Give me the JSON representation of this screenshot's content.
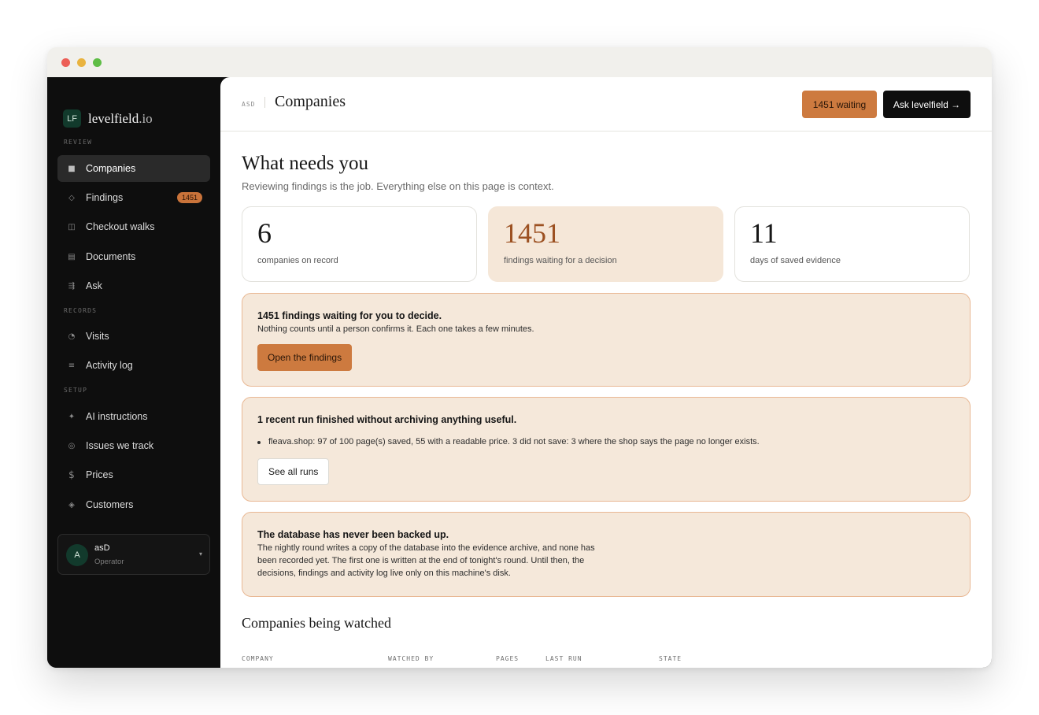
{
  "brand": {
    "mark": "LF",
    "name": "levelfield",
    "tld": ".io"
  },
  "sidebar": {
    "sections": [
      {
        "label": "REVIEW"
      },
      {
        "label": "RECORDS"
      },
      {
        "label": "SETUP"
      }
    ],
    "items": [
      {
        "label": "Companies",
        "icon": "■",
        "icon_name": "companies-icon",
        "active": true
      },
      {
        "label": "Findings",
        "icon": "◇",
        "icon_name": "findings-icon",
        "badge": "1451"
      },
      {
        "label": "Checkout walks",
        "icon": "◫",
        "icon_name": "checkout-walks-icon"
      },
      {
        "label": "Documents",
        "icon": "▤",
        "icon_name": "documents-icon"
      },
      {
        "label": "Ask",
        "icon": "⇶",
        "icon_name": "ask-icon"
      },
      {
        "label": "Visits",
        "icon": "◔",
        "icon_name": "visits-icon"
      },
      {
        "label": "Activity log",
        "icon": "≡",
        "icon_name": "activity-log-icon"
      },
      {
        "label": "AI instructions",
        "icon": "✦",
        "icon_name": "ai-instructions-icon"
      },
      {
        "label": "Issues we track",
        "icon": "◎",
        "icon_name": "issues-icon"
      },
      {
        "label": "Prices",
        "icon": "$",
        "icon_name": "prices-icon"
      },
      {
        "label": "Customers",
        "icon": "◈",
        "icon_name": "customers-icon"
      }
    ],
    "user": {
      "initial": "A",
      "name": "asD",
      "role": "Operator",
      "caret": "▾"
    }
  },
  "header": {
    "org": "ASD",
    "title": "Companies",
    "waiting_button": "1451 waiting",
    "ask_button": "Ask levelfield →"
  },
  "main": {
    "heading": "What needs you",
    "subtitle": "Reviewing findings is the job. Everything else on this page is context.",
    "stats": [
      {
        "value": "6",
        "label": "companies on record"
      },
      {
        "value": "1451",
        "label": "findings waiting for a decision"
      },
      {
        "value": "11",
        "label": "days of saved evidence"
      }
    ],
    "alerts": [
      {
        "title": "1451 findings waiting for you to decide.",
        "text": "Nothing counts until a person confirms it. Each one takes a few minutes.",
        "button": "Open the findings"
      },
      {
        "title": "1 recent run finished without archiving anything useful.",
        "bullet": "fleava.shop: 97 of 100 page(s) saved, 55 with a readable price. 3 did not save: 3 where the shop says the page no longer exists.",
        "button": "See all runs"
      },
      {
        "title": "The database has never been backed up.",
        "lines": [
          "The nightly round writes a copy of the database into the evidence archive, and none has",
          "been recorded yet. The first one is written at the end of tonight's round. Until then, the",
          "decisions, findings and activity log live only on this machine's disk."
        ]
      }
    ],
    "table": {
      "title": "Companies being watched",
      "columns": [
        "COMPANY",
        "WATCHED BY",
        "PAGES",
        "LAST RUN",
        "STATE"
      ]
    }
  },
  "colors": {
    "accent": "#cd7a3f",
    "sidebar_bg": "#0e0e0e",
    "alert_bg": "#f5e8da",
    "alert_border": "#e9b894",
    "brand_green": "#123a2c"
  }
}
